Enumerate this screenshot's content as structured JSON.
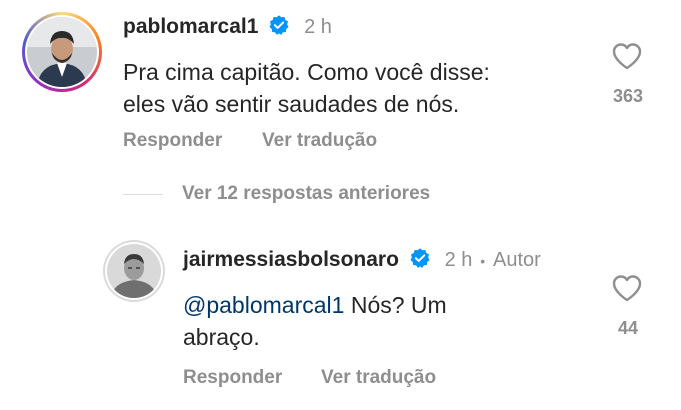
{
  "comment1": {
    "username": "pablomarcal1",
    "time": "2 h",
    "text_line1": "Pra cima capitão. Como você disse:",
    "text_line2": "eles vão sentir saudades de nós.",
    "like_count": "363",
    "reply_label": "Responder",
    "translate_label": "Ver tradução"
  },
  "thread": {
    "view_replies_label": "Ver 12 respostas anteriores"
  },
  "comment2": {
    "username": "jairmessiasbolsonaro",
    "time": "2 h",
    "separator": "•",
    "author_label": "Autor",
    "mention": "@pablomarcal1",
    "text_after_mention": " Nós? Um",
    "text_line2": "abraço.",
    "like_count": "44",
    "reply_label": "Responder",
    "translate_label": "Ver tradução"
  },
  "colors": {
    "verified_blue": "#0095f6",
    "mention_blue": "#00376b",
    "secondary_gray": "#8e8e8e"
  },
  "icons": {
    "verified": "verified-badge-icon",
    "like": "heart-outline-icon"
  }
}
